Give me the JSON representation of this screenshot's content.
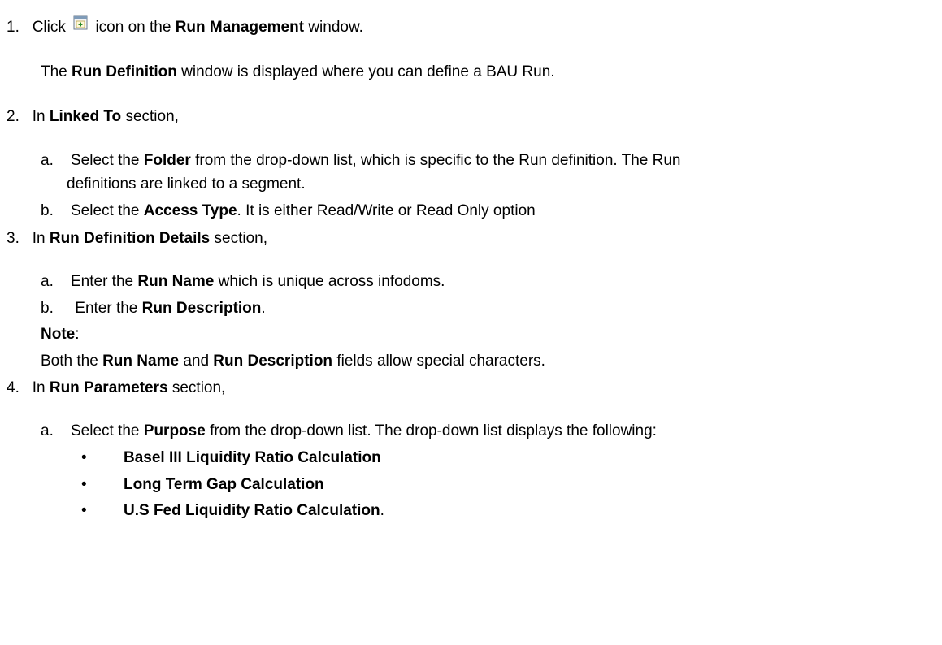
{
  "step1": {
    "num": "1.",
    "click": "Click",
    "icon": "add-icon",
    "rest": "icon on the",
    "target": "Run Management",
    "tail": "window."
  },
  "step1_desc": {
    "pre": "The",
    "bold": "Run Definition",
    "post": "window is displayed where you can define a BAU Run."
  },
  "step2": {
    "num": "2.",
    "pre": "In",
    "bold": "Linked To",
    "post": "section,"
  },
  "step2a": {
    "letter": "a.",
    "pre": "Select the",
    "bold": "Folder",
    "post": "from the drop-down list, which is specific to the Run definition. The Run",
    "cont": "definitions are linked to a segment."
  },
  "step2b": {
    "letter": "b.",
    "pre": "Select the",
    "bold": "Access Type",
    "post": ". It is either Read/Write or Read Only option"
  },
  "step3": {
    "num": "3.",
    "pre": "In",
    "bold": "Run Definition Details",
    "post": "section,"
  },
  "step3a": {
    "letter": "a.",
    "pre": "Enter the",
    "bold": "Run Name",
    "post": "which is unique across infodoms."
  },
  "step3b": {
    "letter": "b.",
    "pre": "Enter the",
    "bold": "Run Description",
    "post": "."
  },
  "note": {
    "label": "Note",
    "colon": ":",
    "pre": "Both the",
    "bold1": "Run Name",
    "and": "and",
    "bold2": "Run Description",
    "post": "fields allow special characters."
  },
  "step4": {
    "num": "4.",
    "pre": "In",
    "bold": "Run Parameters",
    "post": "section,"
  },
  "step4a": {
    "letter": "a.",
    "pre": "Select the",
    "bold": "Purpose",
    "post": "from the drop-down list. The drop-down list displays the following:"
  },
  "purposes": [
    {
      "bullet": "•",
      "label": "Basel III Liquidity Ratio Calculation",
      "suffix": ""
    },
    {
      "bullet": "•",
      "label": "Long Term Gap Calculation",
      "suffix": ""
    },
    {
      "bullet": "•",
      "label": "U.S Fed Liquidity Ratio Calculation",
      "suffix": "."
    }
  ]
}
